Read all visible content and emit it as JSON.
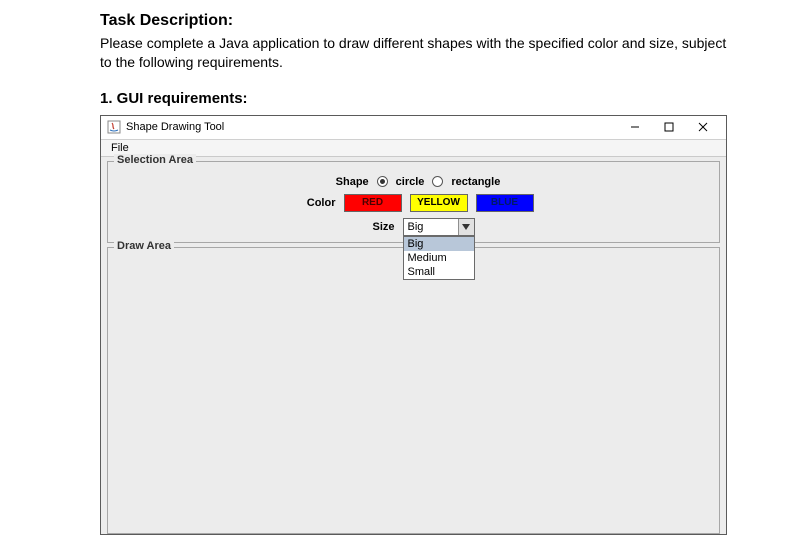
{
  "doc": {
    "heading": "Task Description:",
    "description": "Please complete a Java application to draw different shapes with the specified color and size, subject to the following requirements.",
    "subheading": "1. GUI requirements:"
  },
  "window": {
    "title": "Shape Drawing Tool",
    "menu": {
      "file": "File"
    },
    "selection_legend": "Selection Area",
    "draw_legend": "Draw Area",
    "shape": {
      "label": "Shape",
      "option1": "circle",
      "option2": "rectangle"
    },
    "color": {
      "label": "Color",
      "red": "RED",
      "yellow": "YELLOW",
      "blue": "BLUE"
    },
    "size": {
      "label": "Size",
      "selected": "Big",
      "opt1": "Big",
      "opt2": "Medium",
      "opt3": "Small"
    }
  }
}
